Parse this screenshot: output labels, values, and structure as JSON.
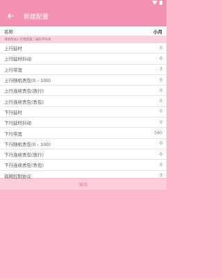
{
  "toolbar": {
    "title": "新建配置"
  },
  "name_row": {
    "label": "名称",
    "value": "小月"
  },
  "hint": "请修改加入可用配置二维码字符串",
  "rows": [
    {
      "label": "上行延时",
      "value": "0"
    },
    {
      "label": "上行延时抖动",
      "value": "0"
    },
    {
      "label": "上行带宽",
      "value": "3"
    },
    {
      "label": "上行随机丢包(0 - 100)",
      "value": "0"
    },
    {
      "label": "上行连续丢包(放行)",
      "value": "0"
    },
    {
      "label": "上行连续丢包(丢包)",
      "value": "0"
    },
    {
      "label": "下行延时",
      "value": "0"
    },
    {
      "label": "下行延时抖动",
      "value": "0"
    },
    {
      "label": "下行带宽",
      "value": "560"
    },
    {
      "label": "下行随机丢包(0 - 100)",
      "value": "0"
    },
    {
      "label": "下行连续丢包(放行)",
      "value": "0"
    },
    {
      "label": "下行连续丢包(丢包)",
      "value": "0"
    },
    {
      "label": "弱网控制协议",
      "value": "3"
    }
  ],
  "save_label": "保存",
  "colors": {
    "primary": "#f490b2",
    "background": "#fdb8cc",
    "divider": "#f1dde4"
  }
}
